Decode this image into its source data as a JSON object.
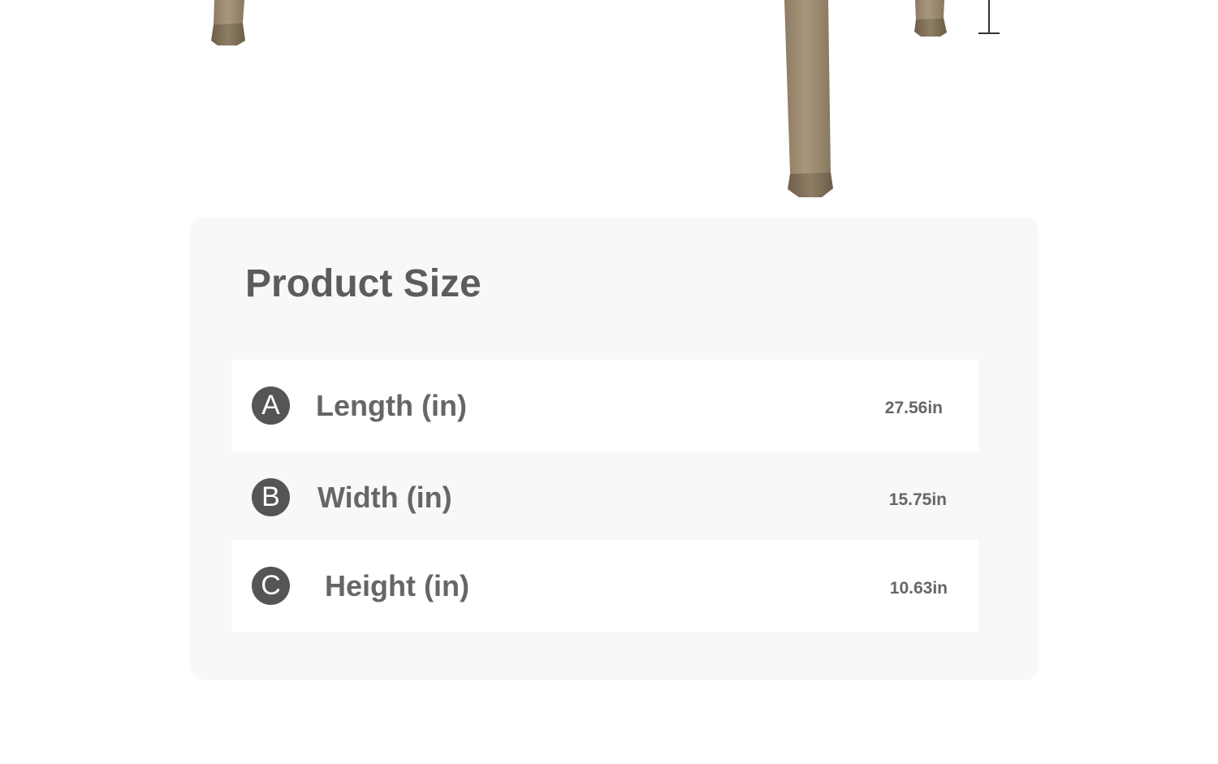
{
  "product_size": {
    "title": "Product Size",
    "rows": [
      {
        "badge": "A",
        "label": "Length (in)",
        "value": "27.56in"
      },
      {
        "badge": "B",
        "label": "Width (in)",
        "value": "15.75in"
      },
      {
        "badge": "C",
        "label": "Height (in)",
        "value": "10.63in"
      }
    ]
  },
  "colors": {
    "card_background": "#f8f8f8",
    "row_highlight": "#ffffff",
    "badge": "#555555",
    "text": "#5c5c5c",
    "table_leg": "#a08f75"
  }
}
